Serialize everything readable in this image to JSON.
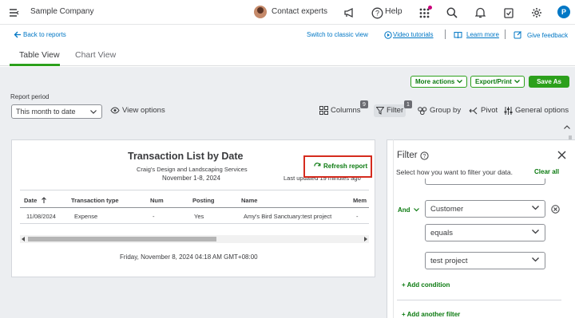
{
  "topbar": {
    "company": "Sample Company",
    "contact_experts": "Contact experts",
    "help": "Help",
    "avatar_letter": "P"
  },
  "subheader": {
    "back": "Back to reports",
    "switch_classic": "Switch to classic view",
    "video_tutorials": "Video tutorials",
    "learn_more": "Learn more",
    "give_feedback": "Give feedback"
  },
  "tabs": [
    {
      "label": "Table View",
      "active": true
    },
    {
      "label": "Chart View",
      "active": false
    }
  ],
  "actions": {
    "more_actions": "More actions",
    "export_print": "Export/Print",
    "save_as": "Save As"
  },
  "period": {
    "label": "Report period",
    "value": "This month to date",
    "view_options": "View options"
  },
  "toolbar": {
    "columns": "Columns",
    "columns_count": "9",
    "filter": "Filter",
    "filter_count": "1",
    "group_by": "Group by",
    "pivot": "Pivot",
    "general_options": "General options"
  },
  "report": {
    "title": "Transaction List by Date",
    "company": "Craig's Design and Landscaping Services",
    "period": "November 1-8, 2024",
    "last_updated": "Last updated 19 minutes ago",
    "refresh": "Refresh report",
    "columns": [
      "Date",
      "Transaction type",
      "Num",
      "Posting",
      "Name",
      "Mem"
    ],
    "rows": [
      [
        "11/08/2024",
        "Expense",
        "-",
        "Yes",
        "Amy's Bird Sanctuary:test project",
        "-"
      ]
    ],
    "footer": "Friday, November 8, 2024 04:18 AM GMT+08:00"
  },
  "filter_panel": {
    "title": "Filter",
    "description": "Select how you want to filter your data.",
    "clear_all": "Clear all",
    "and_label": "And",
    "field": "Customer",
    "operator": "equals",
    "value": "test project",
    "add_condition": "+ Add condition",
    "add_another_filter": "+ Add another filter"
  },
  "colors": {
    "brand_green": "#2ca01c",
    "link_blue": "#0077c5",
    "highlight_red": "#d52b1e",
    "avatar_blue": "#0077c5"
  }
}
